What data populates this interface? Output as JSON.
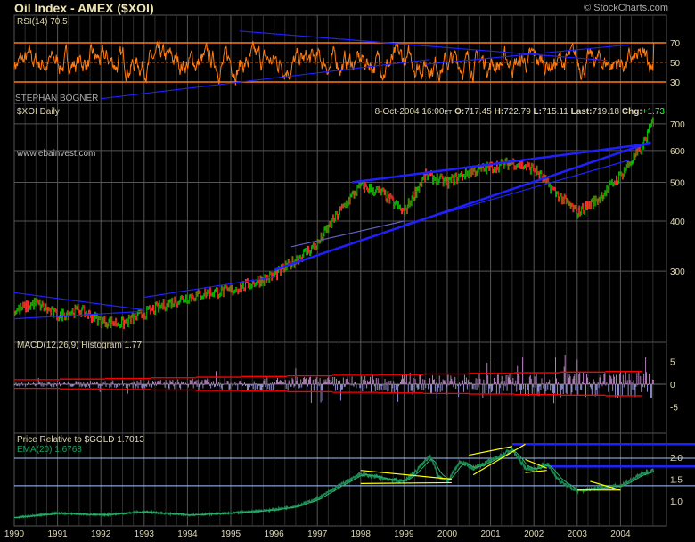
{
  "title": "Oil Index - AMEX ($XOI)",
  "credit": "© StockCharts.com",
  "author": "STEPHAN BOGNER",
  "watermark": "www.ebainvest.com",
  "colors": {
    "rsi": "#ff7a10",
    "price_up": "#00c000",
    "price_down": "#ff2020",
    "trend": "#2020ff",
    "relative": "#1a8a50",
    "macd_hist": "#b090c0",
    "macd_lines": "#ff0000",
    "ref_lines": "#a0c8ff",
    "yellow": "#ffff00"
  },
  "chart_data": [
    {
      "type": "line",
      "name": "rsi",
      "title": "RSI(14) 70.5",
      "yticks": [
        "70",
        "50",
        "30"
      ],
      "levels": [
        70,
        50,
        30
      ],
      "ylim": [
        10,
        90
      ],
      "last": 70.5
    },
    {
      "type": "line",
      "name": "price",
      "title": "$XOI Daily",
      "quote": {
        "date": "8-Oct-2004 16:00",
        "tz": "ET",
        "open_label": "O:",
        "open": "717.45",
        "high_label": "H:",
        "high": "722.79",
        "low_label": "L:",
        "low": "715.11",
        "last_label": "Last:",
        "last": "719.18",
        "chg_label": "Chg:",
        "chg": "+1.73"
      },
      "scale": "log",
      "ylim": [
        200,
        760
      ],
      "yticks": [
        "700",
        "600",
        "500",
        "400",
        "300"
      ],
      "x": [
        1990.0,
        1990.5,
        1991.0,
        1991.5,
        1992.0,
        1992.5,
        1993.0,
        1993.5,
        1994.0,
        1994.5,
        1995.0,
        1995.5,
        1996.0,
        1996.5,
        1997.0,
        1997.5,
        1998.0,
        1998.5,
        1999.0,
        1999.5,
        2000.0,
        2000.5,
        2001.0,
        2001.5,
        2002.0,
        2002.5,
        2003.0,
        2003.5,
        2004.0,
        2004.5,
        2004.77
      ],
      "y": [
        238,
        250,
        232,
        240,
        225,
        222,
        235,
        248,
        258,
        265,
        268,
        280,
        292,
        320,
        350,
        420,
        490,
        470,
        420,
        520,
        500,
        530,
        545,
        560,
        540,
        470,
        420,
        455,
        520,
        610,
        719
      ]
    },
    {
      "type": "bar",
      "name": "macd",
      "title": "MACD(12,26,9) Histogram",
      "last": "1.77",
      "yticks": [
        "5",
        "0",
        "-5"
      ],
      "ylim": [
        -9.5,
        10
      ]
    },
    {
      "type": "line",
      "name": "relative",
      "title": "Price Relative to $GOLD",
      "last": "1.7013",
      "ema_title": "EMA(20)",
      "ema_last": "1.6768",
      "yticks": [
        "2.0",
        "1.5",
        "1.0"
      ],
      "ylim": [
        0.4,
        2.5
      ],
      "x": [
        1990.0,
        1991.0,
        1992.0,
        1993.0,
        1994.0,
        1995.0,
        1996.0,
        1996.5,
        1997.0,
        1997.5,
        1998.0,
        1998.5,
        1999.0,
        1999.3,
        1999.6,
        1999.8,
        2000.0,
        2000.3,
        2000.6,
        2001.0,
        2001.5,
        2001.8,
        2002.0,
        2002.3,
        2002.6,
        2003.0,
        2003.5,
        2004.0,
        2004.5,
        2004.77
      ],
      "y": [
        0.62,
        0.72,
        0.68,
        0.75,
        0.68,
        0.72,
        0.8,
        0.88,
        1.05,
        1.35,
        1.62,
        1.52,
        1.45,
        1.7,
        2.05,
        1.55,
        1.45,
        1.9,
        1.75,
        1.92,
        2.18,
        1.75,
        1.72,
        1.85,
        1.45,
        1.22,
        1.3,
        1.35,
        1.62,
        1.7
      ]
    },
    {
      "type": "axis",
      "name": "x-axis",
      "xticks": [
        "1990",
        "1991",
        "1992",
        "1993",
        "1994",
        "1995",
        "1996",
        "1997",
        "1998",
        "1999",
        "2000",
        "2001",
        "2002",
        "2003",
        "2004"
      ]
    }
  ]
}
